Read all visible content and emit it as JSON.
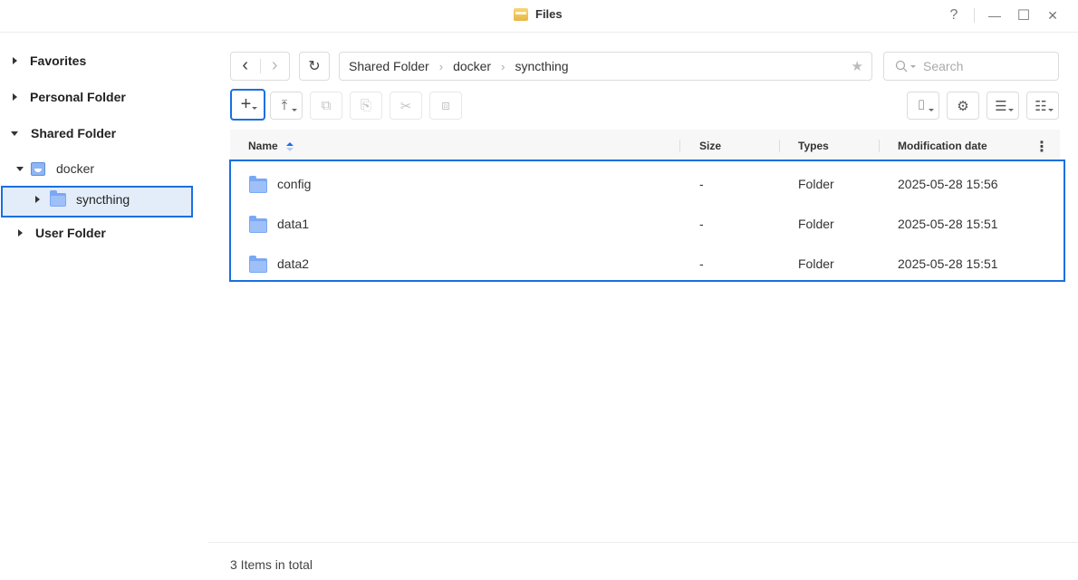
{
  "window": {
    "title": "Files",
    "help_label": "?",
    "minimize_label": "—",
    "maximize_label": "☐",
    "close_label": "✕"
  },
  "sidebar": {
    "favorites": "Favorites",
    "personal_folder": "Personal Folder",
    "shared_folder": "Shared Folder",
    "docker": "docker",
    "syncthing": "syncthing",
    "user_folder": "User Folder"
  },
  "toolbar": {
    "back_icon": "‹",
    "forward_icon": "›",
    "refresh_icon": "↻",
    "breadcrumb": [
      "Shared Folder",
      "docker",
      "syncthing"
    ],
    "breadcrumb_sep": "›",
    "star_icon": "★",
    "search_placeholder": "Search",
    "create_icon": "+",
    "upload_icon": "⤒",
    "copy_icon": "⧉",
    "paste_icon": "⎘",
    "cut_icon": "✂",
    "duplicate_icon": "⧈",
    "tools_icon": "⌷",
    "settings_icon": "⚙",
    "view_icon": "☰",
    "sort_icon": "☷"
  },
  "table": {
    "columns": [
      "Name",
      "Size",
      "Types",
      "Modification date"
    ],
    "more_icon": "⋮",
    "rows": [
      {
        "name": "config",
        "size": "-",
        "type": "Folder",
        "modified": "2025-05-28 15:56"
      },
      {
        "name": "data1",
        "size": "-",
        "type": "Folder",
        "modified": "2025-05-28 15:51"
      },
      {
        "name": "data2",
        "size": "-",
        "type": "Folder",
        "modified": "2025-05-28 15:51"
      }
    ]
  },
  "status": {
    "total": "3 Items in total"
  },
  "colors": {
    "accent": "#1a6fe0",
    "folder": "#7ba7f3",
    "selected_bg": "#e3ecf9"
  }
}
